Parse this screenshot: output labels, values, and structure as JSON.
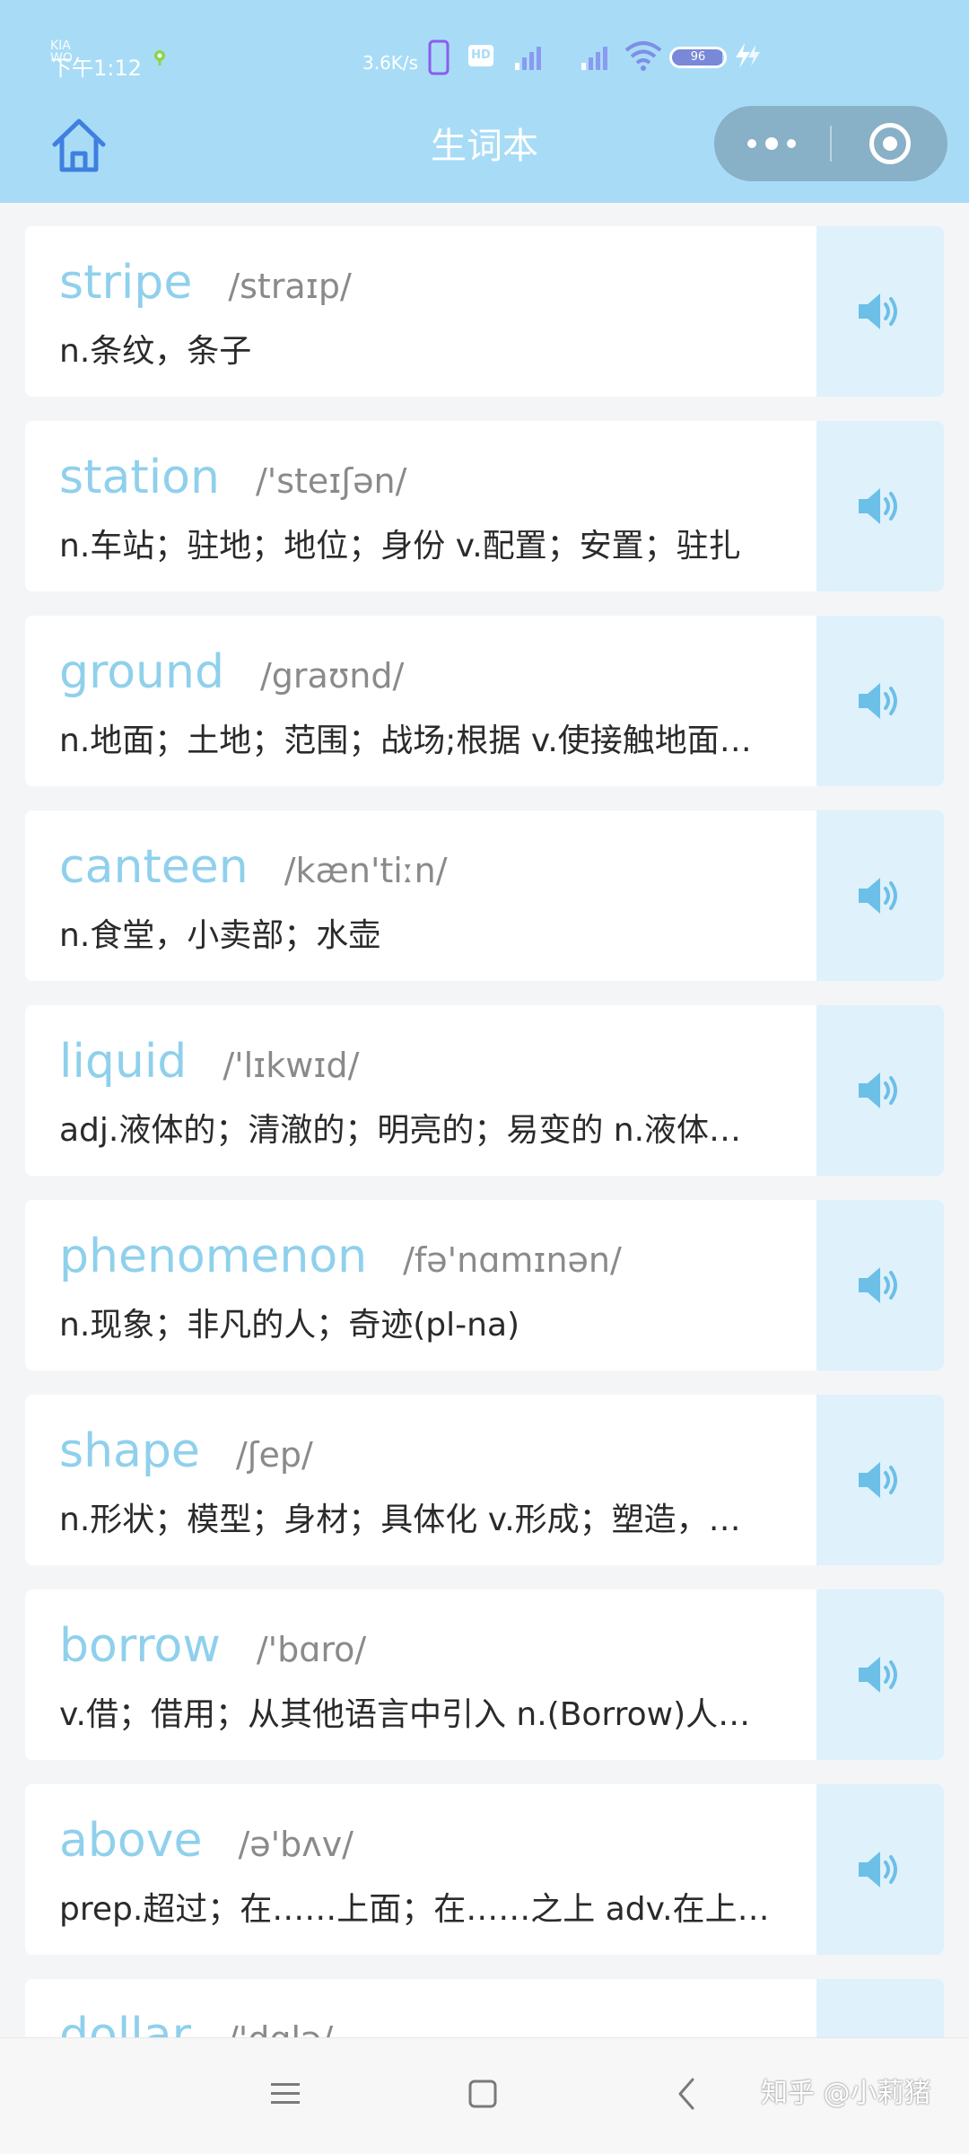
{
  "status_bar": {
    "carrier": "KIA  WO",
    "time": "下午1:12",
    "net_speed": "3.6K/s",
    "hd_badge": "HD",
    "battery_percent": "96",
    "battery_level": 0.96
  },
  "header": {
    "title": "生词本",
    "home_icon": "home-icon",
    "more_icon": "more-dots-icon",
    "close_icon": "target-close-icon"
  },
  "words": [
    {
      "term": "stripe",
      "phonetic": "/straɪp/",
      "definition": "n.条纹，条子"
    },
    {
      "term": "station",
      "phonetic": "/'steɪʃən/",
      "definition": "n.车站；驻地；地位；身份 v.配置；安置；驻扎"
    },
    {
      "term": "ground",
      "phonetic": "/graʊnd/",
      "definition": "n.地面；土地；范围；战场;根据 v.使接触地面…"
    },
    {
      "term": "canteen",
      "phonetic": "/kæn'tiːn/",
      "definition": "n.食堂，小卖部；水壶"
    },
    {
      "term": "liquid",
      "phonetic": "/'lɪkwɪd/",
      "definition": "adj.液体的；清澈的；明亮的；易变的 n.液体…"
    },
    {
      "term": "phenomenon",
      "phonetic": "/fə'nɑmɪnən/",
      "definition": "n.现象；非凡的人；奇迹(pl-na)"
    },
    {
      "term": "shape",
      "phonetic": "/ʃep/",
      "definition": "n.形状；模型；身材；具体化 v.形成；塑造，…"
    },
    {
      "term": "borrow",
      "phonetic": "/'bɑro/",
      "definition": "v.借；借用；从其他语言中引入 n.(Borrow)人…"
    },
    {
      "term": "above",
      "phonetic": "/ə'bʌv/",
      "definition": "prep.超过；在……上面；在……之上 adv.在上…"
    },
    {
      "term": "dollar",
      "phonetic": "/'dɑlə/",
      "definition": ""
    }
  ],
  "speaker_icon": "speaker-icon",
  "nav_bar": {
    "menu_icon": "menu-icon",
    "home_icon": "square-home-icon",
    "back_icon": "back-chevron-icon",
    "watermark": "知乎 @小莉猪"
  },
  "colors": {
    "header_bg": "#a8dcf6",
    "term_color": "#8fd0ec",
    "speaker_bg": "#dff1fb",
    "speaker_icon": "#6cc0e8",
    "page_bg": "#f4f5f7"
  }
}
